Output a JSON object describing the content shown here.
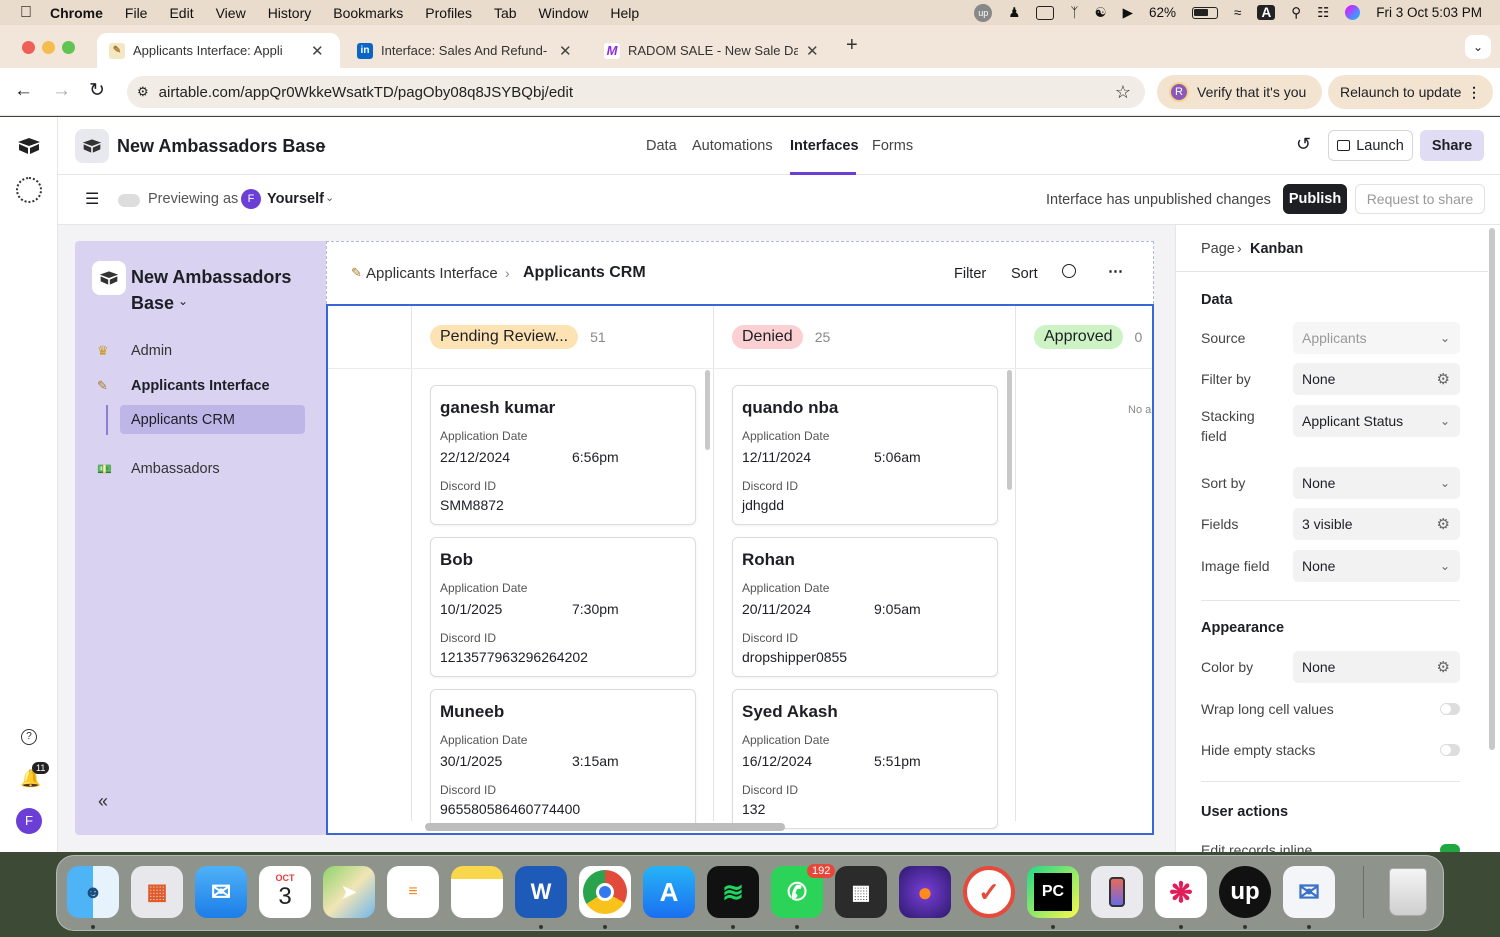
{
  "menubar": {
    "app": "Chrome",
    "items": [
      "File",
      "Edit",
      "View",
      "History",
      "Bookmarks",
      "Profiles",
      "Tab",
      "Window",
      "Help"
    ],
    "battery": "62%",
    "input_source": "A",
    "clock": "Fri 3 Oct  5:03 PM"
  },
  "browser": {
    "tabs": [
      {
        "title": "Applicants Interface: Appli",
        "favicon": "notepad-emoji",
        "active": true
      },
      {
        "title": "Interface: Sales And Refund-",
        "favicon": "linkedin-icon",
        "active": false
      },
      {
        "title": "RADOM SALE - New Sale Dat",
        "favicon": "make-icon",
        "active": false
      }
    ],
    "url": "airtable.com/appQr0WkkeWsatkTD/pagOby08q8JSYBQbj/edit",
    "verify_label": "Verify that it's you",
    "verify_avatar": "R",
    "relaunch_label": "Relaunch to update"
  },
  "airtable": {
    "base_name": "New Ambassadors Base",
    "nav_tabs": [
      "Data",
      "Automations",
      "Interfaces",
      "Forms"
    ],
    "active_nav": "Interfaces",
    "launch_label": "Launch",
    "share_label": "Share",
    "previewing_label": "Previewing as",
    "preview_user_initial": "F",
    "preview_user": "Yourself",
    "unpublished_text": "Interface has unpublished changes",
    "publish_label": "Publish",
    "request_share_label": "Request to share",
    "notifications_count": "11",
    "user_initial": "F"
  },
  "sidebar": {
    "base_name_line1": "New Ambassadors",
    "base_name_line2": "Base",
    "items": [
      {
        "label": "Admin",
        "emoji": "crown"
      },
      {
        "label": "Applicants Interface",
        "emoji": "notepad"
      },
      {
        "label": "Applicants CRM",
        "emoji": ""
      },
      {
        "label": "Ambassadors",
        "emoji": "money"
      }
    ]
  },
  "page": {
    "breadcrumb_parent": "Applicants Interface",
    "breadcrumb_current": "Applicants CRM",
    "filter_label": "Filter",
    "sort_label": "Sort"
  },
  "kanban": {
    "stacks": [
      {
        "name": "Pending Review...",
        "count": "51",
        "color": "#fde3b3",
        "cards": [
          {
            "name": "ganesh kumar",
            "date_label": "Application Date",
            "date": "22/12/2024",
            "time": "6:56pm",
            "discord_label": "Discord ID",
            "discord": "SMM8872"
          },
          {
            "name": "Bob",
            "date_label": "Application Date",
            "date": "10/1/2025",
            "time": "7:30pm",
            "discord_label": "Discord ID",
            "discord": "1213577963296264202"
          },
          {
            "name": "Muneeb",
            "date_label": "Application Date",
            "date": "30/1/2025",
            "time": "3:15am",
            "discord_label": "Discord ID",
            "discord": "965580586460774400"
          }
        ]
      },
      {
        "name": "Denied",
        "count": "25",
        "color": "#fbd0d3",
        "cards": [
          {
            "name": "quando nba",
            "date_label": "Application Date",
            "date": "12/11/2024",
            "time": "5:06am",
            "discord_label": "Discord ID",
            "discord": "jdhgdd"
          },
          {
            "name": "Rohan",
            "date_label": "Application Date",
            "date": "20/11/2024",
            "time": "9:05am",
            "discord_label": "Discord ID",
            "discord": "dropshipper0855"
          },
          {
            "name": "Syed Akash",
            "date_label": "Application Date",
            "date": "16/12/2024",
            "time": "5:51pm",
            "discord_label": "Discord ID",
            "discord": "132"
          }
        ]
      },
      {
        "name": "Approved",
        "count": "0",
        "color": "#cdf2c3",
        "cards": [],
        "empty_text": "No a"
      }
    ]
  },
  "properties": {
    "breadcrumb_parent": "Page",
    "breadcrumb_current": "Kanban",
    "data_heading": "Data",
    "rows": [
      {
        "label": "Source",
        "value": "Applicants",
        "tail": "chevron",
        "muted": true
      },
      {
        "label": "Filter by",
        "value": "None",
        "tail": "gear"
      },
      {
        "label": "Stacking field",
        "value": "Applicant Status",
        "tail": "chevron"
      },
      {
        "label": "Sort by",
        "value": "None",
        "tail": "chevron"
      },
      {
        "label": "Fields",
        "value": "3 visible",
        "tail": "gear"
      },
      {
        "label": "Image field",
        "value": "None",
        "tail": "chevron"
      }
    ],
    "appearance_heading": "Appearance",
    "color_by_label": "Color by",
    "color_by_value": "None",
    "wrap_label": "Wrap long cell values",
    "hide_empty_label": "Hide empty stacks",
    "user_actions_heading": "User actions",
    "edit_inline_label": "Edit records inline"
  },
  "dock": {
    "calendar_month": "OCT",
    "calendar_day": "3",
    "whatsapp_badge": "192",
    "apps": [
      "Finder",
      "Launchpad",
      "Mail",
      "Calendar",
      "Maps",
      "Reminders",
      "Notes",
      "Word",
      "Chrome",
      "App Store",
      "Spotify",
      "WhatsApp",
      "Calculator",
      "Firefox",
      "Tick",
      "PyCharm",
      "iPhone Mirroring",
      "Slack",
      "Upwork",
      "Outlook",
      "Trash"
    ]
  }
}
